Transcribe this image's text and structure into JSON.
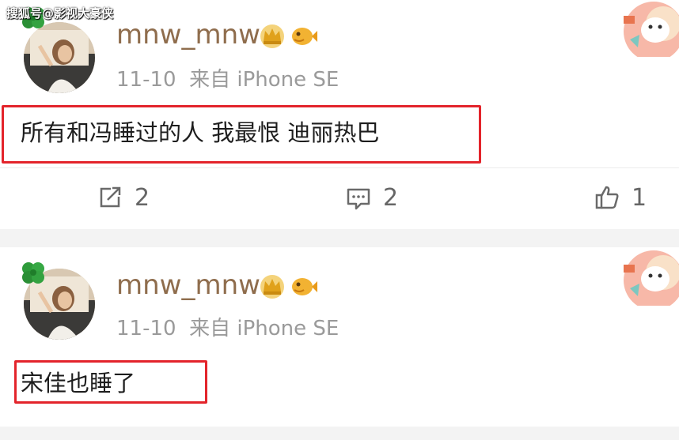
{
  "watermark": "搜狐号@影视大豪侠",
  "posts": [
    {
      "username": "mnw_mnw",
      "time": "11-10",
      "source": "来自 iPhone SE",
      "content": "所有和冯睡过的人 我最恨 迪丽热巴",
      "repost_count": "2",
      "comment_count": "2",
      "like_count": "1"
    },
    {
      "username": "mnw_mnw",
      "time": "11-10",
      "source": "来自 iPhone SE",
      "content": "宋佳也睡了"
    }
  ],
  "colors": {
    "username": "#8f6d4d",
    "highlight_border": "#e3242b",
    "meta": "#9a9a9a",
    "separator": "#f3f3f3"
  },
  "icons": [
    "clover-icon",
    "crown-badge-icon",
    "fish-badge-icon",
    "repost-icon",
    "comment-icon",
    "like-icon"
  ]
}
